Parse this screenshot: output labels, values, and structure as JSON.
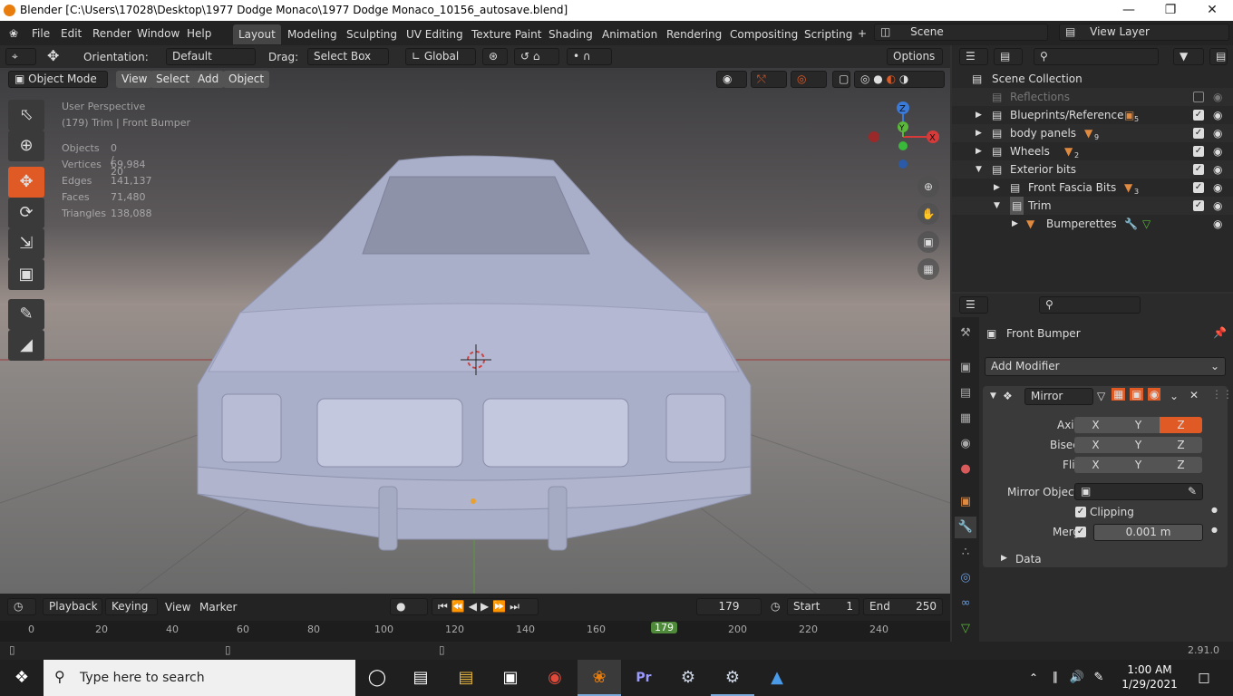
{
  "window": {
    "title": "Blender [C:\\Users\\17028\\Desktop\\1977 Dodge Monaco\\1977 Dodge Monaco_10156_autosave.blend]"
  },
  "menu": [
    "File",
    "Edit",
    "Render",
    "Window",
    "Help"
  ],
  "workspaces": [
    "Layout",
    "Modeling",
    "Sculpting",
    "UV Editing",
    "Texture Paint",
    "Shading",
    "Animation",
    "Rendering",
    "Compositing",
    "Scripting"
  ],
  "scene": "Scene",
  "view_layer": "View Layer",
  "toolheader": {
    "orientation_label": "Orientation:",
    "orientation_value": "Default",
    "drag_label": "Drag:",
    "drag_value": "Select Box",
    "transform_space": "Global",
    "options": "Options"
  },
  "viewport_header": {
    "mode": "Object Mode",
    "view": "View",
    "select": "Select",
    "add": "Add",
    "object": "Object"
  },
  "overlay": {
    "perspective": "User Perspective",
    "context": "(179) Trim | Front Bumper",
    "stats": [
      {
        "label": "Objects",
        "value": "0 / 20"
      },
      {
        "label": "Vertices",
        "value": "69,984"
      },
      {
        "label": "Edges",
        "value": "141,137"
      },
      {
        "label": "Faces",
        "value": "71,480"
      },
      {
        "label": "Triangles",
        "value": "138,088"
      }
    ]
  },
  "gizmo": {
    "x": "X",
    "y": "Y",
    "z": "Z"
  },
  "timeline": {
    "playback": "Playback",
    "keying": "Keying",
    "view": "View",
    "marker": "Marker",
    "current_frame": "179",
    "start_label": "Start",
    "start": "1",
    "end_label": "End",
    "end": "250",
    "ticks": [
      "0",
      "20",
      "40",
      "60",
      "80",
      "100",
      "120",
      "140",
      "160",
      "179",
      "200",
      "220",
      "240"
    ]
  },
  "outliner": {
    "root": "Scene Collection",
    "rows": [
      {
        "label": "Reflections",
        "badge": ""
      },
      {
        "label": "Blueprints/Reference",
        "badge": "5"
      },
      {
        "label": "body panels",
        "badge": "9"
      },
      {
        "label": "Wheels",
        "badge": "2"
      },
      {
        "label": "Exterior bits",
        "badge": ""
      },
      {
        "label": "Front Fascia Bits",
        "badge": "3"
      },
      {
        "label": "Trim",
        "badge": ""
      },
      {
        "label": "Bumperettes",
        "badge": ""
      }
    ]
  },
  "properties": {
    "object_name": "Front Bumper",
    "add_modifier": "Add Modifier",
    "modifier_name": "Mirror",
    "axis_label": "Axis",
    "bisect_label": "Bisect",
    "flip_label": "Flip",
    "x": "X",
    "y": "Y",
    "z": "Z",
    "mirror_object_label": "Mirror Object",
    "clipping_label": "Clipping",
    "merge_label": "Merge",
    "merge_value": "0.001 m",
    "data_label": "Data"
  },
  "status": {
    "version": "2.91.0"
  },
  "taskbar": {
    "search_placeholder": "Type here to search",
    "time": "1:00 AM",
    "date": "1/29/2021"
  },
  "colors": {
    "accent": "#e05a26",
    "active_tab": "#454545"
  }
}
